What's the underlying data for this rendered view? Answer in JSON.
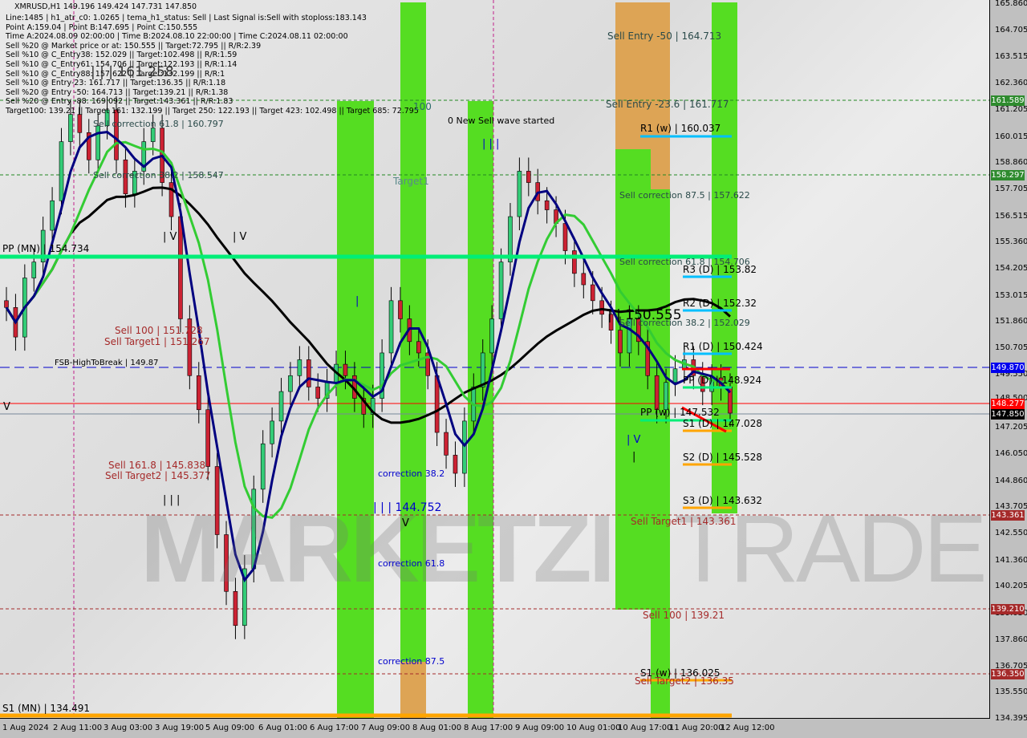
{
  "header": {
    "symbol_line": "XMRUSD,H1  149.196 149.424 147.731 147.850",
    "info_lines": [
      "Line:1485 | h1_atr_c0: 1.0265 | tema_h1_status: Sell | Last Signal is:Sell with stoploss:183.143",
      "Point A:159.04 | Point B:147.695 | Point C:150.555",
      "Time A:2024.08.09 02:00:00 | Time B:2024.08.10 22:00:00 | Time C:2024.08.11 02:00:00",
      "Sell %20 @ Market price or at: 150.555 || Target:72.795 || R/R:2.39",
      "Sell %10 @ C_Entry38: 152.029 || Target:102.498 || R/R:1.59",
      "Sell %10 @ C_Entry61: 154.706 || Target:122.193 || R/R:1.14",
      "Sell %10 @ C_Entry88: 157.622 || Target:132.199 || R/R:1",
      "Sell %10 @ Entry-23: 161.717 || Target:136.35 || R/R:1.18",
      "Sell %20 @ Entry -50: 164.713 || Target:139.21 || R/R:1.38",
      "Sell %20 @ Entry -88: 169.092 || Target:143.361 || R/R:1.83",
      "Target100: 139.21 || Target 161: 132.199 || Target 250: 122.193 || Target 423: 102.498 || Target 685: 72.795"
    ]
  },
  "watermark": {
    "left": "MARKETZI",
    "right": "TRADE"
  },
  "chart_data": {
    "type": "candlestick",
    "title": "XMRUSD,H1",
    "ylim": [
      134.0,
      166.0
    ],
    "y_ticks": [
      165.86,
      164.705,
      163.515,
      162.36,
      161.205,
      160.015,
      158.86,
      157.705,
      156.515,
      155.36,
      154.205,
      153.015,
      151.86,
      150.705,
      149.55,
      148.5,
      147.205,
      146.05,
      144.86,
      143.705,
      142.55,
      141.36,
      140.205,
      139.03,
      137.86,
      136.705,
      135.55,
      134.395
    ],
    "x_ticks": [
      "1 Aug 2024",
      "2 Aug 11:00",
      "3 Aug 03:00",
      "3 Aug 19:00",
      "5 Aug 09:00",
      "6 Aug 01:00",
      "6 Aug 17:00",
      "7 Aug 09:00",
      "8 Aug 01:00",
      "8 Aug 17:00",
      "9 Aug 09:00",
      "10 Aug 01:00",
      "10 Aug 17:00",
      "11 Aug 20:00",
      "12 Aug 12:00"
    ],
    "price_tags": [
      {
        "value": "161.589",
        "color": "#2e8b2e"
      },
      {
        "value": "158.297",
        "color": "#2e8b2e"
      },
      {
        "value": "149.870",
        "color": "#0000ee"
      },
      {
        "value": "148.277",
        "color": "#ff0000"
      },
      {
        "value": "147.850",
        "color": "#000000"
      },
      {
        "value": "143.361",
        "color": "#a52a2a"
      },
      {
        "value": "139.210",
        "color": "#a52a2a"
      },
      {
        "value": "136.350",
        "color": "#a52a2a"
      }
    ],
    "ohlc_last": {
      "open": 149.196,
      "high": 149.424,
      "low": 147.731,
      "close": 147.85
    },
    "close_series": [
      152.5,
      151.2,
      153.8,
      154.5,
      155.9,
      157.2,
      159.8,
      161.0,
      160.2,
      159.0,
      160.5,
      161.2,
      159.0,
      157.5,
      158.5,
      159.8,
      160.4,
      158.0,
      156.5,
      152.0,
      149.5,
      148.0,
      145.5,
      142.5,
      140.0,
      138.5,
      141.0,
      144.5,
      146.5,
      147.5,
      148.8,
      149.5,
      150.2,
      149.0,
      148.5,
      149.2,
      150.0,
      149.5,
      148.5,
      147.8,
      148.5,
      150.5,
      152.8,
      152.0,
      151.0,
      150.5,
      149.5,
      147.0,
      146.0,
      145.2,
      147.5,
      149.0,
      150.5,
      152.0,
      154.5,
      156.5,
      158.5,
      158.0,
      157.2,
      156.8,
      156.2,
      155.0,
      154.0,
      153.5,
      152.8,
      152.2,
      151.5,
      150.5,
      152.0,
      151.0,
      149.5,
      148.0,
      149.2,
      149.8,
      150.2,
      149.5,
      148.8,
      149.4,
      149.0,
      147.85
    ],
    "levels": [
      {
        "label": "PP (MN) | 154.734",
        "value": 154.734,
        "color": "#00ee77"
      },
      {
        "label": "S1 (MN) | 134.491",
        "value": 134.491,
        "color": "#ffa500"
      },
      {
        "label": "R1 (w) | 160.037",
        "value": 160.037,
        "color": "#00bfff"
      },
      {
        "label": "PP (w) | 147.532",
        "value": 147.532,
        "color": "#00ee77"
      },
      {
        "label": "S1 (w) | 136.025",
        "value": 136.025,
        "color": "#ffa500"
      },
      {
        "label": "R3 (D) | 153.82",
        "value": 153.82,
        "color": "#00bfff"
      },
      {
        "label": "R2 (D) | 152.32",
        "value": 152.32,
        "color": "#00bfff"
      },
      {
        "label": "R1 (D) | 150.424",
        "value": 150.424,
        "color": "#00bfff"
      },
      {
        "label": "PP (D) | 148.924",
        "value": 148.924,
        "color": "#00ee77"
      },
      {
        "label": "S1 (D) | 147.028",
        "value": 147.028,
        "color": "#ffa500"
      },
      {
        "label": "S2 (D) | 145.528",
        "value": 145.528,
        "color": "#ffa500"
      },
      {
        "label": "S3 (D) | 143.632",
        "value": 143.632,
        "color": "#ffa500"
      }
    ],
    "annotations": [
      "Sell Entry -50 | 164.713",
      "Sell Entry -23.6 | 161.717",
      "Sell correction 87.5 | 157.622",
      "Sell correction 61.8 | 154.706",
      "Sell correction 38.2 | 152.029",
      "| | 150.555",
      "Sell Target1 | 143.361",
      "Sell 100 | 139.21",
      "Sell Target2 | 136.35",
      "Sell correction 61.8 | 160.797",
      "Sell correction 38.2 | 158.547",
      "Sell 100 | 151.728",
      "Sell Target1 | 151.267",
      "FSB-HighToBreak | 149.87",
      "Sell 161.8 | 145.838",
      "Sell Target2 | 145.377",
      "| | | 144.752",
      "correction 38.2",
      "correction 61.8",
      "correction 87.5",
      "0 New Sell wave started",
      "100",
      "Target1",
      "| | | 161.258"
    ],
    "wave_labels": [
      "| V",
      "| V",
      "| | |",
      "| | |",
      "V",
      "| V",
      "|",
      "V",
      "|"
    ]
  }
}
